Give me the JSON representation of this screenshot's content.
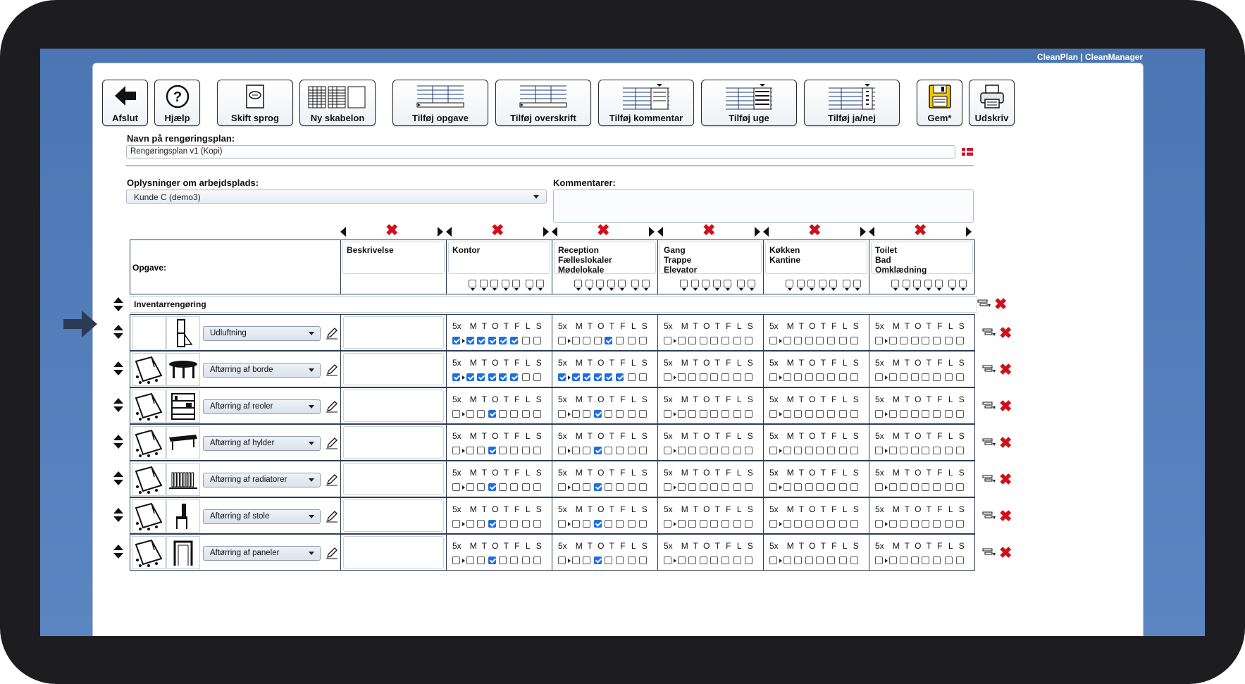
{
  "brand": "CleanPlan | CleanManager",
  "toolbar": {
    "afslut": "Afslut",
    "hjaelp": "Hjælp",
    "skift_sprog": "Skift sprog",
    "ny_skabelon": "Ny skabelon",
    "tilfoej_opgave": "Tilføj opgave",
    "tilfoej_overskrift": "Tilføj overskrift",
    "tilfoej_kommentar": "Tilføj kommentar",
    "tilfoej_uge": "Tilføj uge",
    "tilfoej_janej": "Tilføj ja/nej",
    "gem": "Gem*",
    "udskriv": "Udskriv"
  },
  "form": {
    "name_label": "Navn på rengøringsplan:",
    "name_value": "Rengøringsplan v1 (Kopi)",
    "workplace_label": "Oplysninger om arbejdsplads:",
    "workplace_value": "Kunde C (demo3)",
    "comments_label": "Kommentarer:"
  },
  "grid": {
    "task_header": "Opgave:",
    "desc_header": "Beskrivelse",
    "category": "Inventarrengøring",
    "day_labels": [
      "5x",
      "M",
      "T",
      "O",
      "T",
      "F",
      "L",
      "S"
    ],
    "zones": [
      {
        "l1": "Kontor",
        "l2": "",
        "l3": ""
      },
      {
        "l1": "Reception",
        "l2": "Fælleslokaler",
        "l3": "Mødelokale"
      },
      {
        "l1": "Gang",
        "l2": "Trappe",
        "l3": "Elevator"
      },
      {
        "l1": "Køkken",
        "l2": "Kantine",
        "l3": ""
      },
      {
        "l1": "Toilet",
        "l2": "Bad",
        "l3": "Omklædning"
      }
    ],
    "tasks": [
      {
        "name": "Udluftning",
        "icon1": "blank",
        "icon2": "window-icon",
        "zones": [
          [
            1,
            1,
            1,
            1,
            1,
            1,
            0,
            0
          ],
          [
            0,
            0,
            0,
            0,
            1,
            0,
            0,
            0
          ],
          [
            0,
            0,
            0,
            0,
            0,
            0,
            0,
            0
          ],
          [
            0,
            0,
            0,
            0,
            0,
            0,
            0,
            0
          ],
          [
            0,
            0,
            0,
            0,
            0,
            0,
            0,
            0
          ]
        ]
      },
      {
        "name": "Aftørring af borde",
        "icon1": "cloth-icon",
        "icon2": "table-icon",
        "zones": [
          [
            1,
            1,
            1,
            1,
            1,
            1,
            0,
            0
          ],
          [
            1,
            1,
            1,
            1,
            1,
            1,
            0,
            0
          ],
          [
            0,
            0,
            0,
            0,
            0,
            0,
            0,
            0
          ],
          [
            0,
            0,
            0,
            0,
            0,
            0,
            0,
            0
          ],
          [
            0,
            0,
            0,
            0,
            0,
            0,
            0,
            0
          ]
        ]
      },
      {
        "name": "Aftørring af reoler",
        "icon1": "cloth-icon",
        "icon2": "shelf-icon",
        "zones": [
          [
            0,
            0,
            0,
            1,
            0,
            0,
            0,
            0
          ],
          [
            0,
            0,
            0,
            1,
            0,
            0,
            0,
            0
          ],
          [
            0,
            0,
            0,
            0,
            0,
            0,
            0,
            0
          ],
          [
            0,
            0,
            0,
            0,
            0,
            0,
            0,
            0
          ],
          [
            0,
            0,
            0,
            0,
            0,
            0,
            0,
            0
          ]
        ]
      },
      {
        "name": "Aftørring af hylder",
        "icon1": "cloth-icon",
        "icon2": "bench-icon",
        "zones": [
          [
            0,
            0,
            0,
            1,
            0,
            0,
            0,
            0
          ],
          [
            0,
            0,
            0,
            1,
            0,
            0,
            0,
            0
          ],
          [
            0,
            0,
            0,
            0,
            0,
            0,
            0,
            0
          ],
          [
            0,
            0,
            0,
            0,
            0,
            0,
            0,
            0
          ],
          [
            0,
            0,
            0,
            0,
            0,
            0,
            0,
            0
          ]
        ]
      },
      {
        "name": "Aftørring af radiatorer",
        "icon1": "cloth-icon",
        "icon2": "radiator-icon",
        "zones": [
          [
            0,
            0,
            0,
            1,
            0,
            0,
            0,
            0
          ],
          [
            0,
            0,
            0,
            1,
            0,
            0,
            0,
            0
          ],
          [
            0,
            0,
            0,
            0,
            0,
            0,
            0,
            0
          ],
          [
            0,
            0,
            0,
            0,
            0,
            0,
            0,
            0
          ],
          [
            0,
            0,
            0,
            0,
            0,
            0,
            0,
            0
          ]
        ]
      },
      {
        "name": "Aftørring af stole",
        "icon1": "cloth-icon",
        "icon2": "chair-icon",
        "zones": [
          [
            0,
            0,
            0,
            1,
            0,
            0,
            0,
            0
          ],
          [
            0,
            0,
            0,
            1,
            0,
            0,
            0,
            0
          ],
          [
            0,
            0,
            0,
            0,
            0,
            0,
            0,
            0
          ],
          [
            0,
            0,
            0,
            0,
            0,
            0,
            0,
            0
          ],
          [
            0,
            0,
            0,
            0,
            0,
            0,
            0,
            0
          ]
        ]
      },
      {
        "name": "Aftørring af paneler",
        "icon1": "cloth-icon",
        "icon2": "door-frame-icon",
        "zones": [
          [
            0,
            0,
            0,
            1,
            0,
            0,
            0,
            0
          ],
          [
            0,
            0,
            0,
            1,
            0,
            0,
            0,
            0
          ],
          [
            0,
            0,
            0,
            0,
            0,
            0,
            0,
            0
          ],
          [
            0,
            0,
            0,
            0,
            0,
            0,
            0,
            0
          ],
          [
            0,
            0,
            0,
            0,
            0,
            0,
            0,
            0
          ]
        ]
      }
    ]
  }
}
